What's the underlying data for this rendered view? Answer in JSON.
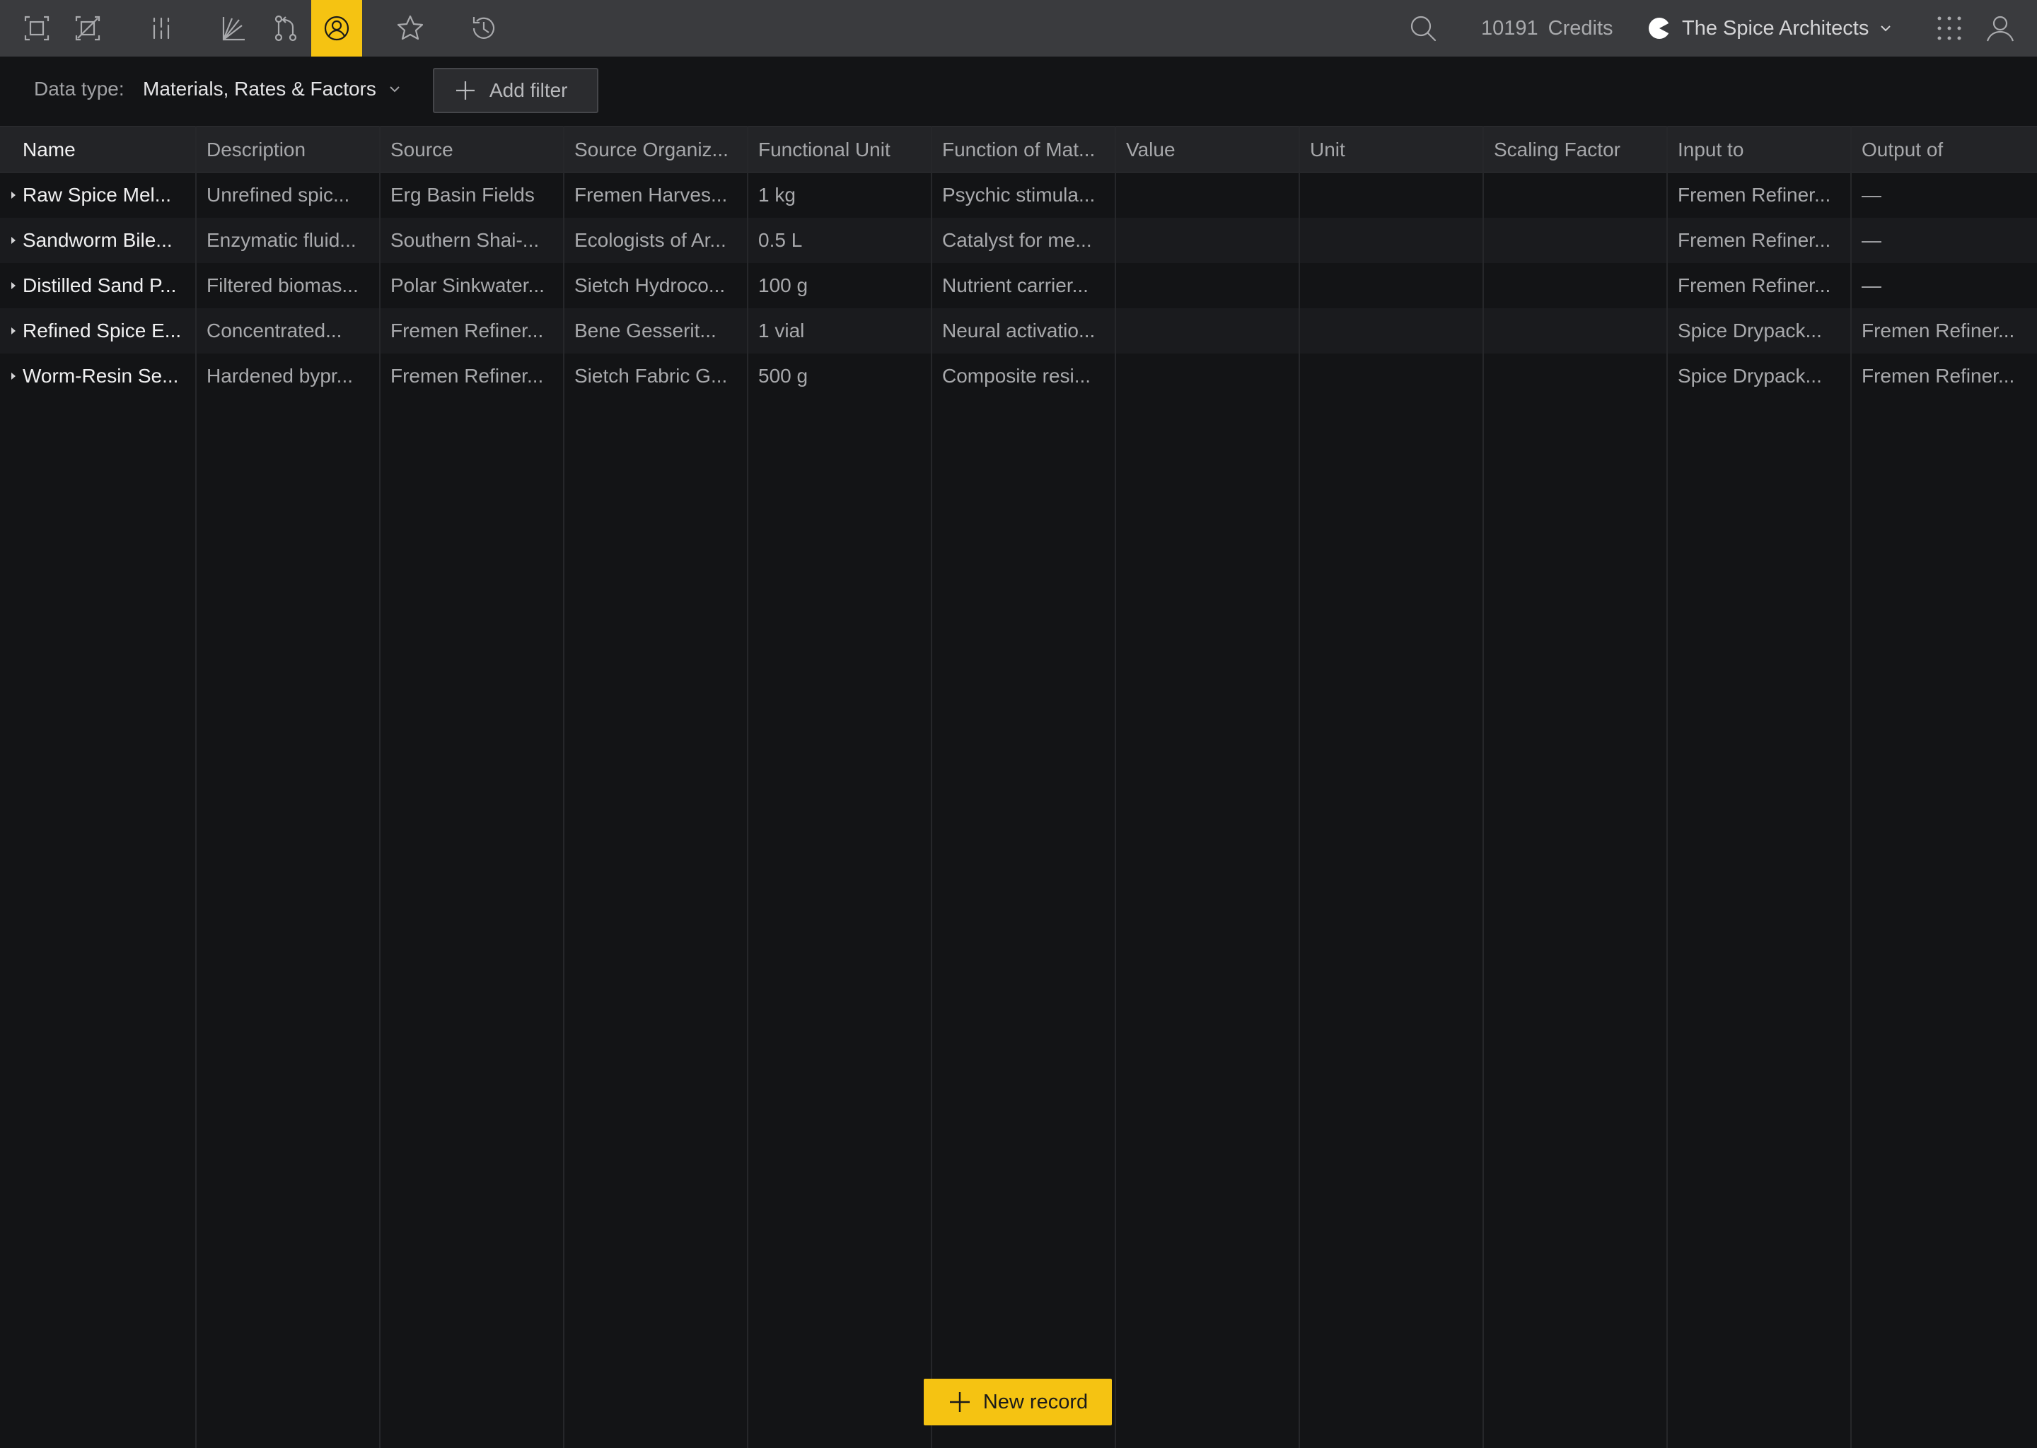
{
  "topbar": {
    "icons": [
      "select-frame-icon",
      "no-frame-icon",
      "columns-icon",
      "chart-axes-icon",
      "branch-icon",
      "user-circle-icon",
      "star-icon",
      "history-icon"
    ],
    "active_icon": "user-circle-icon",
    "credits_value": "10191",
    "credits_label": "Credits",
    "org_name": "The Spice Architects"
  },
  "filterbar": {
    "data_type_label": "Data type:",
    "data_type_value": "Materials, Rates & Factors",
    "add_filter_label": "Add filter"
  },
  "table": {
    "columns": [
      "Name",
      "Description",
      "Source",
      "Source Organiz...",
      "Functional Unit",
      "Function of Mat...",
      "Value",
      "Unit",
      "Scaling Factor",
      "Input to",
      "Output of"
    ],
    "rows": [
      [
        "Raw Spice Mel...",
        "Unrefined spic...",
        "Erg Basin Fields",
        "Fremen Harves...",
        "1 kg",
        "Psychic stimula...",
        "",
        "",
        "",
        "Fremen Refiner...",
        "—"
      ],
      [
        "Sandworm Bile...",
        "Enzymatic fluid...",
        "Southern Shai-...",
        "Ecologists of Ar...",
        "0.5 L",
        "Catalyst for me...",
        "",
        "",
        "",
        "Fremen Refiner...",
        "—"
      ],
      [
        "Distilled Sand P...",
        "Filtered biomas...",
        "Polar Sinkwater...",
        "Sietch Hydroco...",
        "100 g",
        "Nutrient carrier...",
        "",
        "",
        "",
        "Fremen Refiner...",
        "—"
      ],
      [
        "Refined Spice E...",
        "Concentrated...",
        "Fremen Refiner...",
        "Bene Gesserit...",
        "1 vial",
        "Neural activatio...",
        "",
        "",
        "",
        "Spice Drypack...",
        "Fremen Refiner..."
      ],
      [
        "Worm-Resin Se...",
        "Hardened bypr...",
        "Fremen Refiner...",
        "Sietch Fabric G...",
        "500 g",
        "Composite resi...",
        "",
        "",
        "",
        "Spice Drypack...",
        "Fremen Refiner..."
      ]
    ]
  },
  "new_record_label": "New record",
  "colors": {
    "accent": "#f5c312",
    "topbar_bg": "#3a3b3e",
    "page_bg": "#131416",
    "header_bg": "#232427"
  }
}
